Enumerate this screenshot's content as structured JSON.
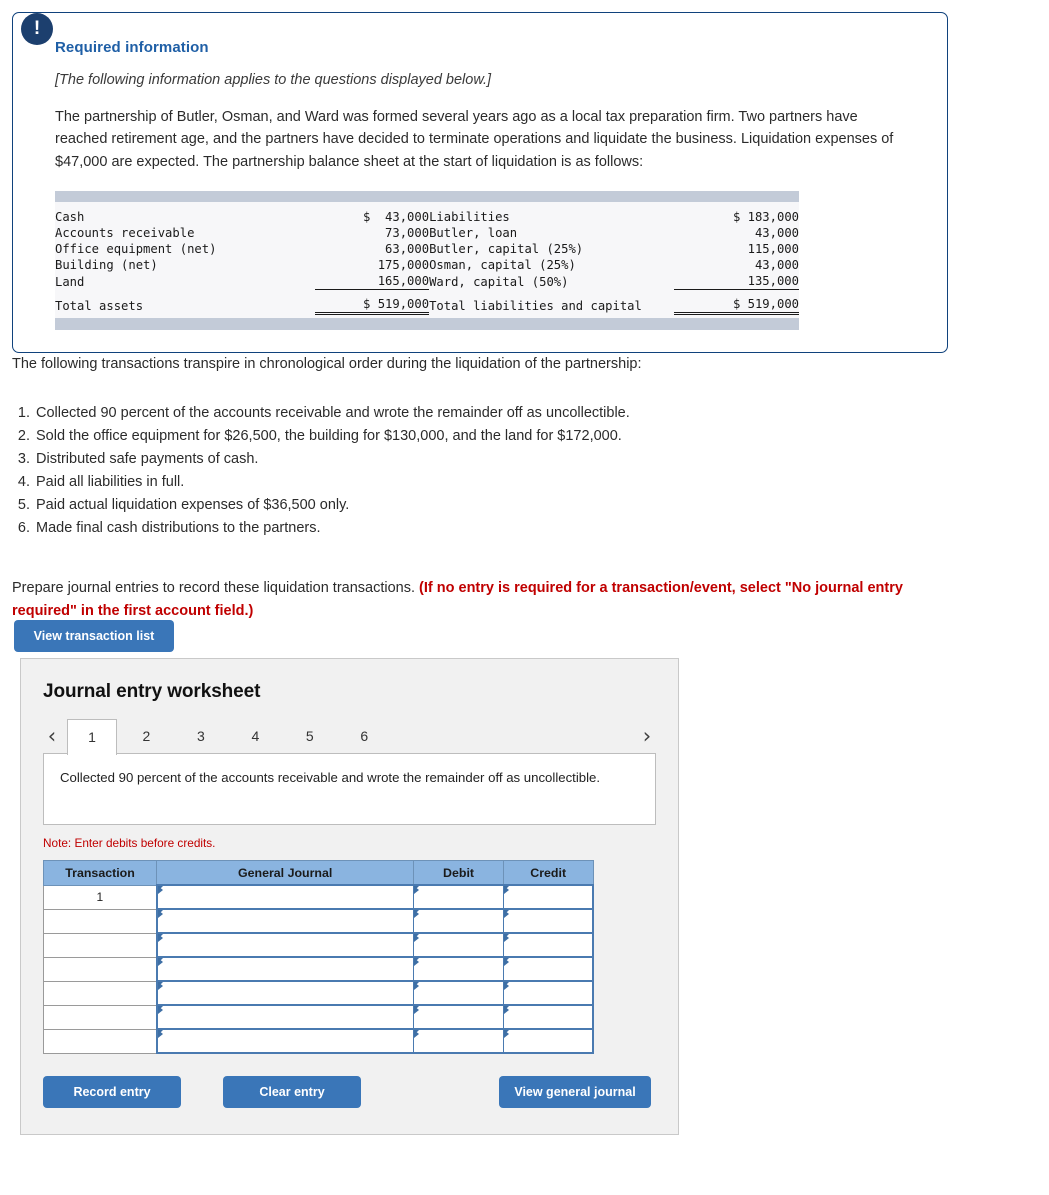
{
  "required_info": {
    "alert_icon": "exclamation-icon",
    "title": "Required information",
    "applies_note": "[The following information applies to the questions displayed below.]",
    "paragraph": "The partnership of Butler, Osman, and Ward was formed several years ago as a local tax preparation firm. Two partners have reached retirement age, and the partners have decided to terminate operations and liquidate the business. Liquidation expenses of $47,000 are expected. The partnership balance sheet at the start of liquidation is as follows:"
  },
  "balance_sheet": {
    "assets": [
      {
        "label": "Cash",
        "amount": "$  43,000"
      },
      {
        "label": "Accounts receivable",
        "amount": "73,000"
      },
      {
        "label": "Office equipment (net)",
        "amount": "63,000"
      },
      {
        "label": "Building (net)",
        "amount": "175,000"
      },
      {
        "label": "Land",
        "amount": "165,000"
      }
    ],
    "assets_total_label": "Total assets",
    "assets_total_amount": "$ 519,000",
    "equities": [
      {
        "label": "Liabilities",
        "amount": "$ 183,000"
      },
      {
        "label": "Butler, loan",
        "amount": "43,000"
      },
      {
        "label": "Butler, capital (25%)",
        "amount": "115,000"
      },
      {
        "label": "Osman, capital (25%)",
        "amount": "43,000"
      },
      {
        "label": "Ward, capital (50%)",
        "amount": "135,000"
      }
    ],
    "equities_total_label": "Total liabilities and capital",
    "equities_total_amount": "$ 519,000"
  },
  "mid": {
    "lead": "The following transactions transpire in chronological order during the liquidation of the partnership:",
    "transactions": [
      "Collected 90 percent of the accounts receivable and wrote the remainder off as uncollectible.",
      "Sold the office equipment for $26,500, the building for $130,000, and the land for $172,000.",
      "Distributed safe payments of cash.",
      "Paid all liabilities in full.",
      "Paid actual liquidation expenses of $36,500 only.",
      "Made final cash distributions to the partners."
    ],
    "prepare_plain": "Prepare journal entries to record these liquidation transactions. ",
    "prepare_red": "(If no entry is required for a transaction/event, select \"No journal entry required\" in the first account field.)",
    "view_transaction_list_label": "View transaction list"
  },
  "worksheet": {
    "title": "Journal entry worksheet",
    "prev_arrow": "‹",
    "next_arrow": "›",
    "tabs": [
      {
        "label": "1",
        "active": true
      },
      {
        "label": "2",
        "active": false
      },
      {
        "label": "3",
        "active": false
      },
      {
        "label": "4",
        "active": false
      },
      {
        "label": "5",
        "active": false
      },
      {
        "label": "6",
        "active": false
      }
    ],
    "active_tab_description": "Collected 90 percent of the accounts receivable and wrote the remainder off as uncollectible.",
    "note": "Note: Enter debits before credits.",
    "table": {
      "headers": [
        "Transaction",
        "General Journal",
        "Debit",
        "Credit"
      ],
      "rows": [
        {
          "transaction": "1",
          "general_journal": "",
          "debit": "",
          "credit": ""
        },
        {
          "transaction": "",
          "general_journal": "",
          "debit": "",
          "credit": ""
        },
        {
          "transaction": "",
          "general_journal": "",
          "debit": "",
          "credit": ""
        },
        {
          "transaction": "",
          "general_journal": "",
          "debit": "",
          "credit": ""
        },
        {
          "transaction": "",
          "general_journal": "",
          "debit": "",
          "credit": ""
        },
        {
          "transaction": "",
          "general_journal": "",
          "debit": "",
          "credit": ""
        },
        {
          "transaction": "",
          "general_journal": "",
          "debit": "",
          "credit": ""
        }
      ]
    },
    "buttons": {
      "record_entry": "Record entry",
      "clear_entry": "Clear entry",
      "view_general_journal": "View general journal"
    }
  },
  "colors": {
    "card_border": "#10427c",
    "accent_blue": "#3a76b8",
    "title_blue": "#1f5fa6",
    "alert_navy": "#1c3f6e",
    "warning_red": "#c00000",
    "table_header_blue": "#8ab4e0",
    "bs_bar": "#c3cbd8",
    "panel_gray": "#f1f1f1"
  }
}
